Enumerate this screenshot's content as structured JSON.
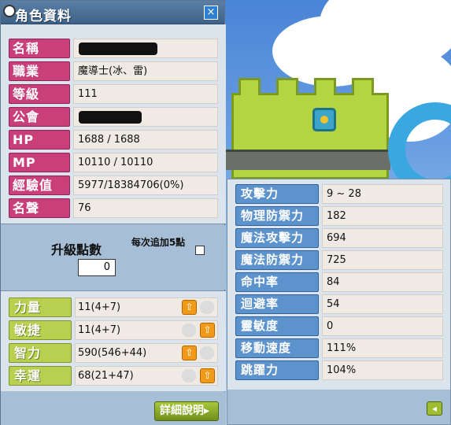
{
  "window": {
    "title": "角色資料",
    "close_icon": "×"
  },
  "profile": [
    {
      "label": "名稱",
      "value": "",
      "redacted": true
    },
    {
      "label": "職業",
      "value": "魔導士(冰、雷)"
    },
    {
      "label": "等級",
      "value": "111"
    },
    {
      "label": "公會",
      "value": "",
      "redacted": true
    },
    {
      "label": "HP",
      "value": "1688 / 1688"
    },
    {
      "label": "MP",
      "value": "10110 / 10110"
    },
    {
      "label": "經驗值",
      "value": "5977/18384706(0%)"
    },
    {
      "label": "名聲",
      "value": "76"
    }
  ],
  "ability_points": {
    "label": "升級點數",
    "value": "0",
    "every5_label": "每次追加5點"
  },
  "stats": [
    {
      "label": "力量",
      "value": "11(4+7)",
      "active_button_side": "left"
    },
    {
      "label": "敏捷",
      "value": "11(4+7)",
      "active_button_side": "right"
    },
    {
      "label": "智力",
      "value": "590(546+44)",
      "active_button_side": "left"
    },
    {
      "label": "幸運",
      "value": "68(21+47)",
      "active_button_side": "right"
    }
  ],
  "detail_button": "詳細說明▸",
  "detail_stats": [
    {
      "label": "攻擊力",
      "value": "9 ~ 28"
    },
    {
      "label": "物理防禦力",
      "value": "182"
    },
    {
      "label": "魔法攻擊力",
      "value": "694"
    },
    {
      "label": "魔法防禦力",
      "value": "725"
    },
    {
      "label": "命中率",
      "value": "84"
    },
    {
      "label": "迴避率",
      "value": "54"
    },
    {
      "label": "靈敏度",
      "value": "0"
    },
    {
      "label": "移動速度",
      "value": "111%"
    },
    {
      "label": "跳躍力",
      "value": "104%"
    }
  ],
  "back_icon": "◂",
  "colors": {
    "profile_label": "#c93f7a",
    "stat_label": "#b8cf4f",
    "detail_label": "#5d93cc",
    "up_button": "#f19a1a"
  }
}
